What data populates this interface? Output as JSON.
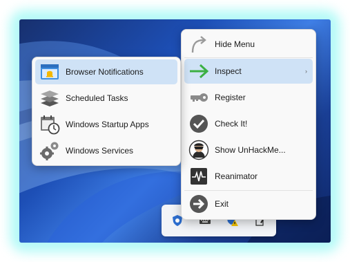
{
  "main_menu": {
    "items": [
      {
        "label": "Hide Menu",
        "icon": "curved-arrow-icon"
      },
      {
        "label": "Inspect",
        "icon": "green-arrow-icon",
        "submenu_indicator": "›"
      },
      {
        "label": "Register",
        "icon": "key-icon"
      },
      {
        "label": "Check It!",
        "icon": "checkmark-circle-icon"
      },
      {
        "label": "Show UnHackMe...",
        "icon": "hacker-avatar-icon"
      },
      {
        "label": "Reanimator",
        "icon": "heartbeat-monitor-icon"
      },
      {
        "label": "Exit",
        "icon": "exit-arrow-icon"
      }
    ]
  },
  "sub_menu": {
    "items": [
      {
        "label": "Browser Notifications",
        "icon": "browser-bell-icon"
      },
      {
        "label": "Scheduled Tasks",
        "icon": "layers-stack-icon"
      },
      {
        "label": "Windows Startup Apps",
        "icon": "calendar-clock-icon"
      },
      {
        "label": "Windows Services",
        "icon": "gears-icon"
      }
    ]
  },
  "tray": {
    "icons": [
      "unhackme-shield-icon",
      "keyboard-icon",
      "security-warning-icon",
      "pen-icon"
    ]
  },
  "colors": {
    "highlight": "#cfe2f6",
    "glow": "#78f5f0",
    "inspect_arrow": "#3cb043"
  }
}
